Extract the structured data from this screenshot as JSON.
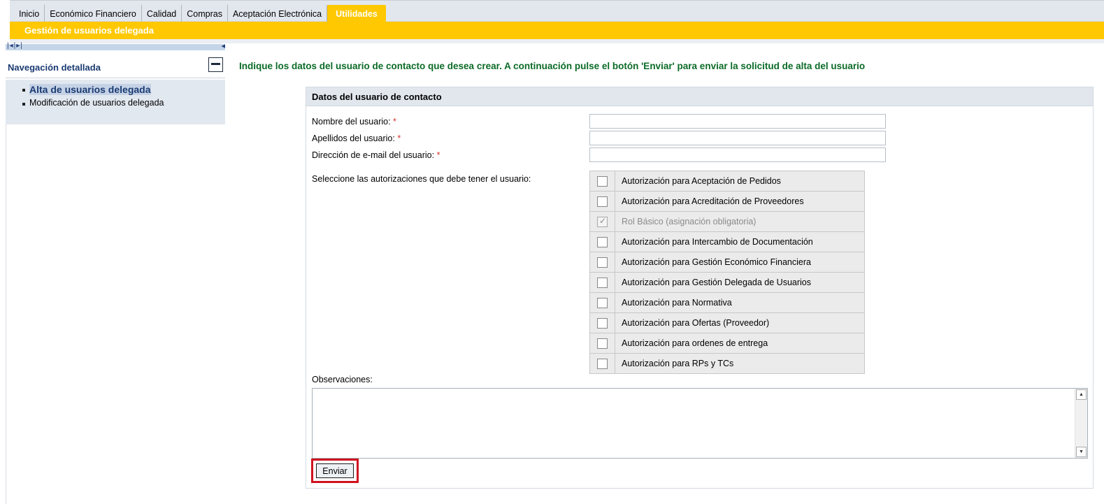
{
  "header": {
    "tabs": [
      {
        "label": "Inicio",
        "active": false
      },
      {
        "label": "Económico Financiero",
        "active": false
      },
      {
        "label": "Calidad",
        "active": false
      },
      {
        "label": "Compras",
        "active": false
      },
      {
        "label": "Aceptación Electrónica",
        "active": false
      },
      {
        "label": "Utilidades",
        "active": true
      }
    ],
    "subtitle": "Gestión de usuarios delegada"
  },
  "colors": {
    "accent_yellow": "#ffc800",
    "nav_blue": "#1b3b72",
    "instruction_green": "#0b6b27",
    "required_red": "#d4342c",
    "highlight_red": "#d0121f"
  },
  "nav": {
    "strip_icons": [
      "first-prev-icon",
      "collapse-left-icon"
    ],
    "title": "Navegación detallada",
    "items": [
      {
        "label": "Alta de usuarios delegada",
        "active": true
      },
      {
        "label": "Modificación de usuarios delegada",
        "active": false
      }
    ]
  },
  "main": {
    "instruction": "Indique los datos del usuario de contacto que desea crear. A continuación pulse el botón 'Enviar' para enviar la solicitud de alta del usuario",
    "panel_title": "Datos del usuario de contacto",
    "fields": {
      "nombre_label": "Nombre del usuario:",
      "apellidos_label": "Apellidos del usuario:",
      "email_label": "Dirección de e-mail del usuario:",
      "required_mark": "*",
      "nombre_value": "",
      "apellidos_value": "",
      "email_value": ""
    },
    "auth_label": "Seleccione las autorizaciones que debe tener el usuario:",
    "authorizations": [
      {
        "label": "Autorización para Aceptación de Pedidos",
        "checked": false,
        "disabled": false
      },
      {
        "label": "Autorización para Acreditación de Proveedores",
        "checked": false,
        "disabled": false
      },
      {
        "label": "Rol Básico (asignación obligatoria)",
        "checked": true,
        "disabled": true
      },
      {
        "label": "Autorización para Intercambio de Documentación",
        "checked": false,
        "disabled": false
      },
      {
        "label": "Autorización para Gestión Económico Financiera",
        "checked": false,
        "disabled": false
      },
      {
        "label": "Autorización para Gestión Delegada de Usuarios",
        "checked": false,
        "disabled": false
      },
      {
        "label": "Autorización para Normativa",
        "checked": false,
        "disabled": false
      },
      {
        "label": "Autorización para Ofertas (Proveedor)",
        "checked": false,
        "disabled": false
      },
      {
        "label": "Autorización para ordenes de entrega",
        "checked": false,
        "disabled": false
      },
      {
        "label": "Autorización para RPs y TCs",
        "checked": false,
        "disabled": false
      }
    ],
    "observaciones_label": "Observaciones:",
    "observaciones_value": "",
    "send_label": "Enviar"
  }
}
